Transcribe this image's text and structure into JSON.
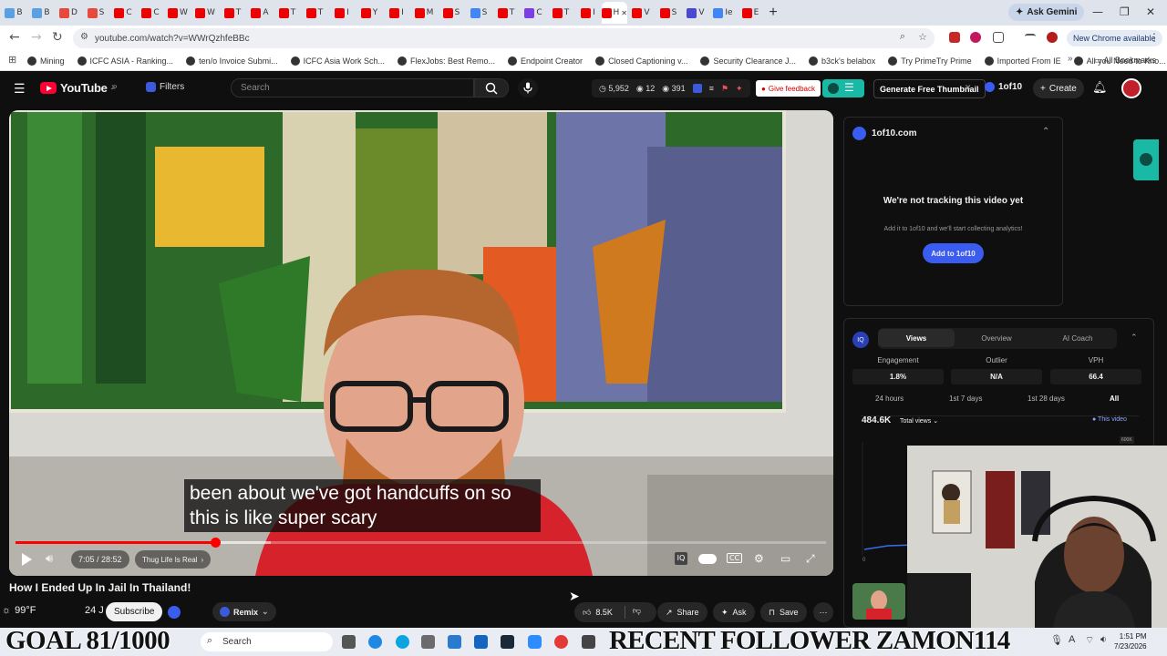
{
  "browser": {
    "tab_labels": [
      "B",
      "B",
      "D",
      "S",
      "C",
      "C",
      "W",
      "W",
      "T",
      "A",
      "T",
      "T",
      "I",
      "Y",
      "I",
      "M",
      "S",
      "S",
      "T",
      "C",
      "T",
      "I",
      "H",
      "V",
      "S",
      "V",
      "Ie",
      "E"
    ],
    "tab_colors": [
      "#5aa1e3",
      "#5aa1e3",
      "#e64a3c",
      "#e64a3c",
      "#e00",
      "#e00",
      "#e00",
      "#e00",
      "#e00",
      "#e00",
      "#e00",
      "#e00",
      "#e00",
      "#e00",
      "#e00",
      "#e00",
      "#e00",
      "#4285f4",
      "#e00",
      "#7b3fe4",
      "#e00",
      "#e00",
      "#e00",
      "#e00",
      "#e00",
      "#4a4ad0",
      "#4285f4",
      "#e00"
    ],
    "active_tab_index": 22,
    "active_tab_label": "H",
    "gemini_label": "Ask Gemini",
    "url": "youtube.com/watch?v=WWrQzhfeBBc",
    "new_chrome_label": "New Chrome available",
    "bookmarks": [
      "Mining",
      "ICFC ASIA - Ranking...",
      "ten/o Invoice Submi...",
      "ICFC Asia Work Sch...",
      "FlexJobs: Best Remo...",
      "Endpoint Creator",
      "Closed Captioning v...",
      "Security Clearance J...",
      "b3ck's belabox",
      "Try PrimeTry Prime",
      "Imported From IE",
      "All you Need to Kno..."
    ],
    "all_bookmarks_label": "All Bookmarks"
  },
  "youtube": {
    "logo_text": "YouTube",
    "logo_suffix": "JP",
    "filters_label": "Filters",
    "search_placeholder": "Search",
    "stats": {
      "views": "5,952",
      "likes": "12",
      "watch": "391"
    },
    "feedback_label": "Give feedback",
    "generate_thumbnail_label": "Generate Free Thumbnail",
    "ext_title": "1of10",
    "create_label": "Create"
  },
  "video": {
    "caption_line1": "been about we've got handcuffs on so",
    "caption_line2": "this is like super scary",
    "time": "7:05 / 28:52",
    "progress": 0.2465,
    "buffered": 0.315,
    "chapter": "Thug Life Is Real",
    "title": "How I Ended Up In Jail In Thailand!",
    "subscribe_label": "Subscribe",
    "channel_partial": "24 J",
    "remix_label": "Remix",
    "likes": "8.5K",
    "share_label": "Share",
    "ask_label": "Ask",
    "save_label": "Save"
  },
  "weather": {
    "temp": "99°F"
  },
  "ofpanel": {
    "title": "1of10.com",
    "heading": "We're not tracking this video yet",
    "desc": "Add it to 1of10 and we'll start collecting analytics!",
    "button": "Add to 1of10"
  },
  "analytics": {
    "tabs": [
      "Views",
      "Overview",
      "AI Coach"
    ],
    "metrics": [
      {
        "label": "Engagement",
        "value": "1.8%"
      },
      {
        "label": "Outlier",
        "value": "N/A"
      },
      {
        "label": "VPH",
        "value": "66.4"
      }
    ],
    "ranges": [
      "24 hours",
      "1st 7 days",
      "1st 28 days",
      "All"
    ],
    "total_views": "484.6K",
    "total_views_label": "Total views",
    "this_video_label": "This video",
    "y_top": "600K",
    "y_zero": "0"
  },
  "stream": {
    "goal_text": "GOAL 81/1000",
    "recent_text": "RECENT FOLLOWER ZAMON114"
  },
  "taskbar": {
    "search_label": "Search",
    "time": "1:51 PM",
    "date": "7/23/2026"
  }
}
